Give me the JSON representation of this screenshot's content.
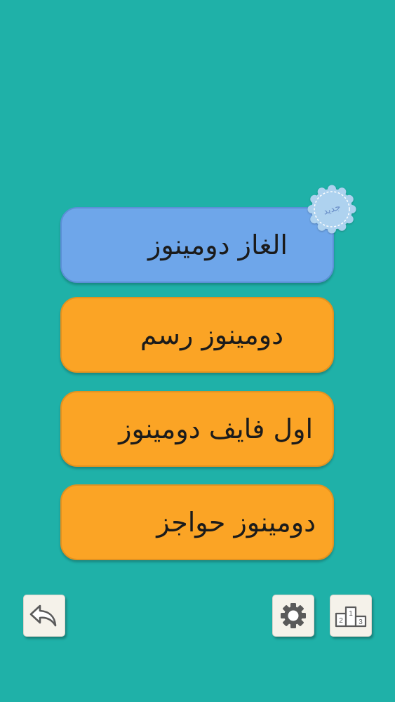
{
  "menu": {
    "items": [
      {
        "label": "الغاز دومينوز",
        "color": "#6ea6ea",
        "badge": "جديد"
      },
      {
        "label": "دومينوز رسم",
        "color": "#fba425"
      },
      {
        "label": "اول فايف دومينوز",
        "color": "#fba425"
      },
      {
        "label": "دومينوز حواجز",
        "color": "#fba425"
      }
    ]
  },
  "toolbar": {
    "back_icon": "back-arrow-icon",
    "settings_icon": "gear-icon",
    "leaderboard_icon": "podium-icon",
    "podium_numbers": [
      "2",
      "1",
      "3"
    ]
  },
  "colors": {
    "background": "#1fb1a8",
    "blue_button": "#6ea6ea",
    "orange_button": "#fba425",
    "toolbar_button": "#f5f2ea"
  }
}
